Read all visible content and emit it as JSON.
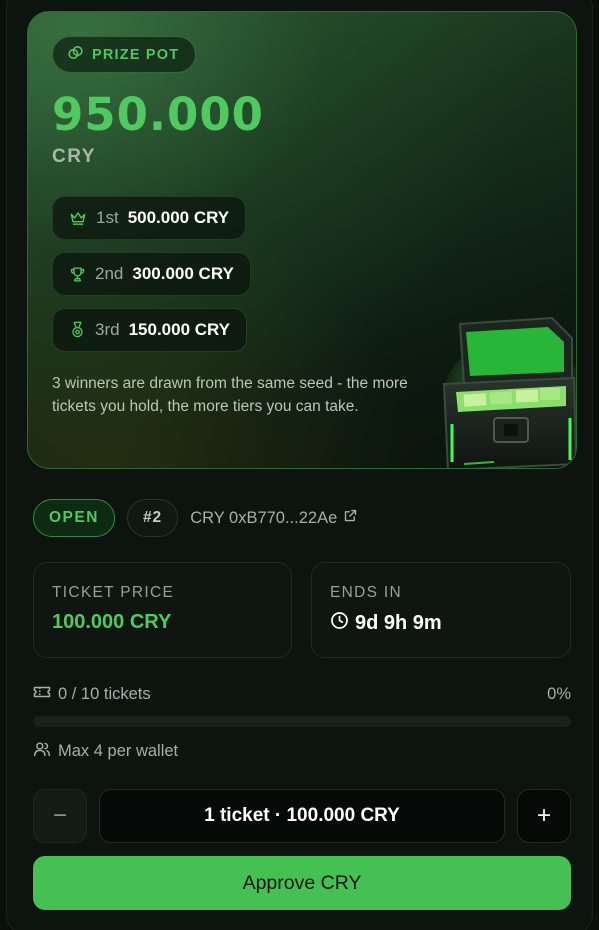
{
  "prize": {
    "badge": "PRIZE POT",
    "amount": "950.000",
    "unit": "CRY",
    "tiers": [
      {
        "rank": "1st",
        "amount": "500.000 CRY",
        "icon": "crown-icon"
      },
      {
        "rank": "2nd",
        "amount": "300.000 CRY",
        "icon": "trophy-icon"
      },
      {
        "rank": "3rd",
        "amount": "150.000 CRY",
        "icon": "medal-icon"
      }
    ],
    "description": "3 winners are drawn from the same seed - the more tickets you hold, the more tiers you can take."
  },
  "status": {
    "state": "OPEN",
    "round": "#2",
    "contract": "CRY 0xB770...22Ae"
  },
  "stats": {
    "ticket_price_label": "TICKET PRICE",
    "ticket_price_value": "100.000 CRY",
    "ends_in_label": "ENDS IN",
    "ends_in_value": "9d 9h 9m"
  },
  "tickets": {
    "sold_text": "0 / 10 tickets",
    "percent_text": "0%",
    "progress_fraction": 0,
    "max_text": "Max 4 per wallet"
  },
  "purchase": {
    "minus": "−",
    "plus": "+",
    "quantity_text": "1 ticket · 100.000 CRY",
    "approve_label": "Approve CRY"
  },
  "colors": {
    "accent": "#4fca5e",
    "button": "#44c152",
    "background": "#0a0f0b"
  }
}
